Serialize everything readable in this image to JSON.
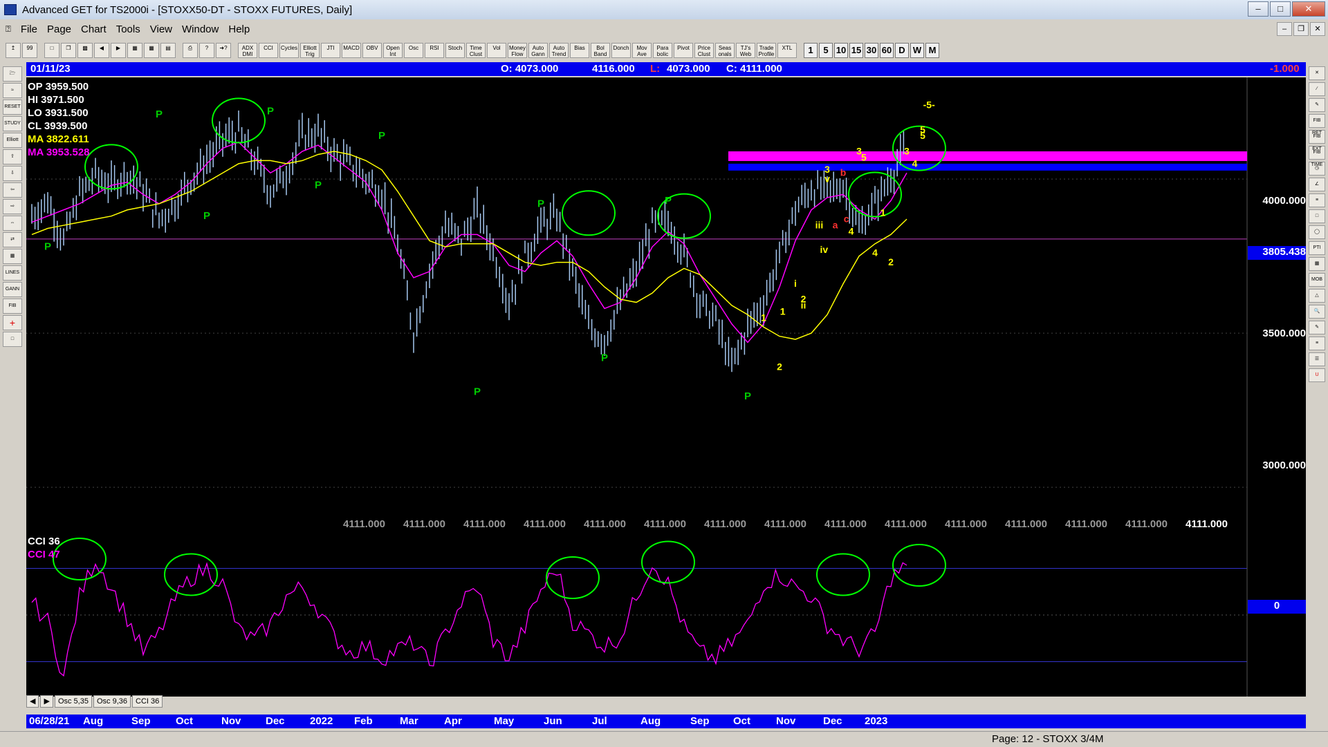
{
  "window": {
    "title": "Advanced GET for TS2000i - [STOXX50-DT - STOXX FUTURES, Daily]",
    "min": "0",
    "max": "1",
    "close": "r"
  },
  "menu": [
    "File",
    "Page",
    "Chart",
    "Tools",
    "View",
    "Window",
    "Help"
  ],
  "toolbar": {
    "indicators": [
      "ADX DMI",
      "CCI",
      "Cycles",
      "Elliott Trig",
      "JTI",
      "MACD",
      "OBV",
      "Open Int",
      "Osc",
      "RSI",
      "Stoch",
      "Time Clust",
      "Vol",
      "Money Flow",
      "Auto Gann",
      "Auto Trend",
      "Bias",
      "Bol Band",
      "Donch",
      "Mov Ave",
      "Para bolic",
      "Pivot",
      "Price Clust",
      "Seas onals",
      "TJ's Web",
      "Trade Profile",
      "XTL"
    ],
    "timeframes": [
      "1",
      "5",
      "10",
      "15",
      "30",
      "60",
      "D",
      "W",
      "M"
    ]
  },
  "header": {
    "date": "01/11/23",
    "open": "O: 4073.000",
    "high": "4116.000",
    "low_label": "L:",
    "low": "4073.000",
    "close": "C: 4111.000",
    "change": "-1.000"
  },
  "data_window": {
    "op": "OP  3959.500",
    "hi": "HI   3971.500",
    "lo": "LO  3931.500",
    "cl": "CL  3939.500",
    "ma1": "MA  3822.611",
    "ma2": "MA  3953.528"
  },
  "price_axis": {
    "labels": [
      "4000.000",
      "3805.438",
      "3500.000",
      "3000.000"
    ]
  },
  "bottom_repeat": {
    "value": "4111.000",
    "count": 15
  },
  "osc": {
    "title1": "CCI 36",
    "title2": "CCI  47",
    "zero": "0",
    "tabs": [
      "Osc 5,35",
      "Osc 9,36",
      "CCI 36"
    ]
  },
  "dates": [
    "06/28/21",
    "Aug",
    "Sep",
    "Oct",
    "Nov",
    "Dec",
    "2022",
    "Feb",
    "Mar",
    "Apr",
    "May",
    "Jun",
    "Jul",
    "Aug",
    "Sep",
    "Oct",
    "Nov",
    "Dec",
    "2023"
  ],
  "status": "Page: 12 - STOXX 3/4M",
  "colors": {
    "bars": "#a6c8f0",
    "ma_fast": "#ff00ff",
    "ma_slow": "#ffff00",
    "pivot": "#00cc00",
    "circle": "#00ff00",
    "wave": "#ffff00",
    "zone_top": "#ff00ff",
    "zone_bottom": "#0000ff"
  },
  "chart_data": {
    "type": "line",
    "series": [
      {
        "name": "close",
        "values": [
          3880,
          3930,
          3800,
          3950,
          4010,
          3980,
          4020,
          3960,
          3870,
          3920,
          4000,
          4060,
          4130,
          4150,
          4060,
          3960,
          4020,
          4140,
          4150,
          4080,
          4050,
          4000,
          3960,
          3790,
          3500,
          3700,
          3850,
          3800,
          3900,
          3770,
          3600,
          3750,
          3850,
          3880,
          3700,
          3520,
          3480,
          3600,
          3700,
          3850,
          3860,
          3760,
          3600,
          3540,
          3390,
          3520,
          3600,
          3750,
          3900,
          3970,
          3960,
          3980,
          3840,
          3920,
          4010,
          4110
        ]
      },
      {
        "name": "MA 3953.528",
        "values": [
          3860,
          3880,
          3900,
          3920,
          3950,
          3980,
          3990,
          3950,
          3920,
          3950,
          3990,
          4050,
          4100,
          4120,
          4070,
          4020,
          4050,
          4090,
          4110,
          4070,
          4030,
          3990,
          3900,
          3760,
          3680,
          3700,
          3780,
          3820,
          3820,
          3790,
          3720,
          3700,
          3760,
          3800,
          3750,
          3660,
          3580,
          3600,
          3680,
          3780,
          3830,
          3790,
          3690,
          3610,
          3530,
          3470,
          3530,
          3650,
          3800,
          3900,
          3940,
          3950,
          3900,
          3870,
          3930,
          4020
        ]
      },
      {
        "name": "MA 3822.611",
        "values": [
          3820,
          3840,
          3850,
          3860,
          3870,
          3880,
          3900,
          3910,
          3920,
          3940,
          3960,
          3990,
          4020,
          4050,
          4060,
          4060,
          4050,
          4060,
          4080,
          4090,
          4080,
          4060,
          4030,
          3960,
          3880,
          3800,
          3780,
          3790,
          3790,
          3790,
          3760,
          3730,
          3720,
          3730,
          3730,
          3700,
          3650,
          3610,
          3600,
          3630,
          3680,
          3710,
          3690,
          3640,
          3590,
          3560,
          3520,
          3490,
          3480,
          3500,
          3560,
          3660,
          3750,
          3790,
          3820,
          3870
        ]
      }
    ],
    "ylim": [
      2850,
      4330
    ],
    "pivot_labels": [
      "P",
      "P",
      "P",
      "P",
      "P",
      "P",
      "P",
      "P",
      "P",
      "P",
      "P",
      "P",
      "P",
      "P"
    ],
    "wave_labels": [
      "1",
      "2",
      "1",
      "2",
      "i",
      "ii",
      "iii",
      "iv",
      "v",
      "3",
      "a",
      "b",
      "c",
      "3",
      "4",
      "5",
      "4",
      "1",
      "2",
      "3",
      "4",
      "5",
      "5",
      "-5-"
    ],
    "osc_series": [
      {
        "name": "CCI 47",
        "values": [
          40,
          -20,
          -200,
          60,
          180,
          90,
          -10,
          -120,
          -60,
          50,
          120,
          150,
          100,
          -50,
          -80,
          -30,
          60,
          90,
          20,
          -70,
          -120,
          -100,
          -140,
          -110,
          -90,
          -160,
          -60,
          40,
          90,
          -80,
          -140,
          -40,
          80,
          150,
          -20,
          -60,
          -100,
          -70,
          60,
          170,
          100,
          -40,
          -120,
          -140,
          -90,
          -30,
          100,
          130,
          90,
          60,
          -30,
          -80,
          -110,
          -60,
          120,
          160
        ]
      }
    ]
  }
}
